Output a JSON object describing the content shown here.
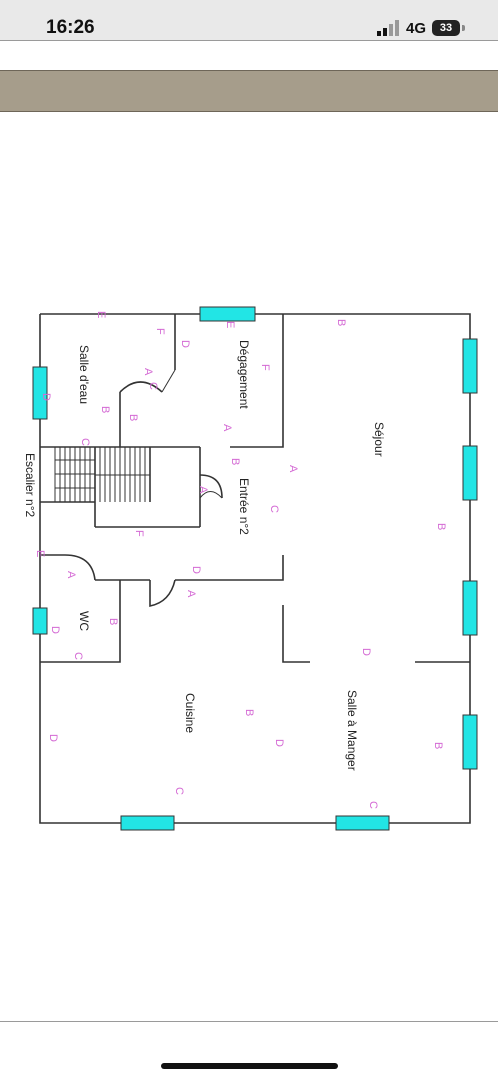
{
  "status_bar": {
    "time": "16:26",
    "network": "4G",
    "battery": "33"
  },
  "floor_plan": {
    "rooms": {
      "salle_deau": "Salle d'eau",
      "degagement": "Dégagement",
      "sejour": "Séjour",
      "escalier": "Escalier n°2",
      "entree": "Entrée n°2",
      "wc": "WC",
      "cuisine": "Cuisine",
      "salle_a_manger": "Salle à Manger"
    },
    "markers": [
      "E",
      "F",
      "A",
      "C",
      "D",
      "B",
      "B",
      "E",
      "D",
      "F",
      "A",
      "B",
      "A",
      "C",
      "F",
      "E",
      "A",
      "D",
      "A",
      "B",
      "D",
      "C",
      "D",
      "B",
      "D",
      "C",
      "A",
      "B",
      "D",
      "C",
      "B",
      "B",
      "C"
    ],
    "colors": {
      "wall": "#333333",
      "window": "#22e5e5",
      "marker": "#d46ad4"
    }
  }
}
